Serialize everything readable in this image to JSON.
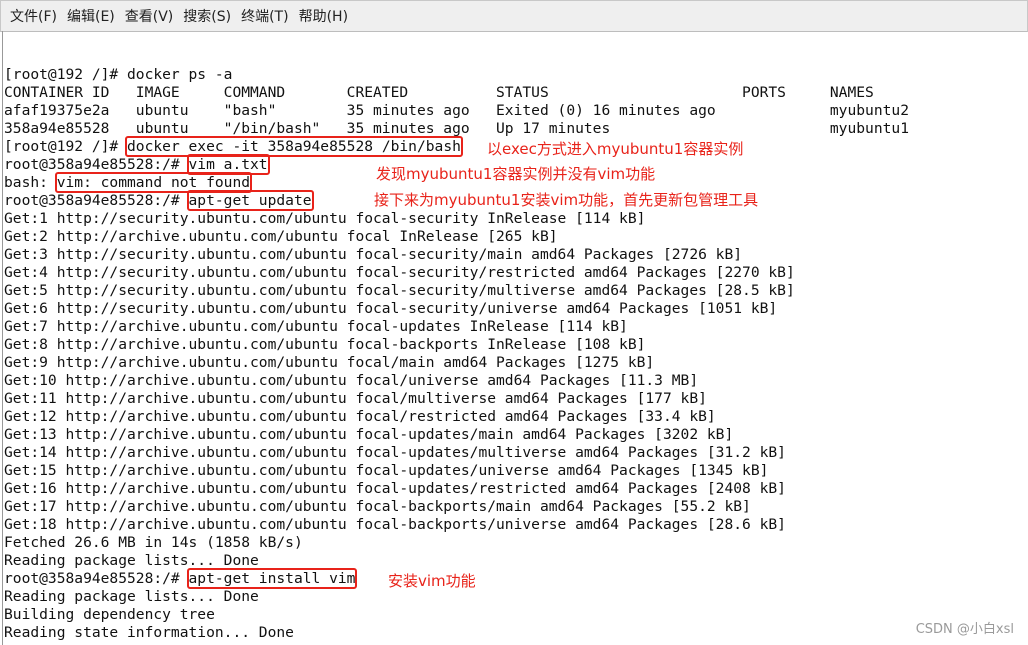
{
  "menu": [
    "文件(F)",
    "编辑(E)",
    "查看(V)",
    "搜索(S)",
    "终端(T)",
    "帮助(H)"
  ],
  "lines": {
    "l0": "[root@192 /]# docker ps -a",
    "l1": "CONTAINER ID   IMAGE     COMMAND       CREATED          STATUS                      PORTS     NAMES",
    "l2": "afaf19375e2a   ubuntu    \"bash\"        35 minutes ago   Exited (0) 16 minutes ago             myubuntu2",
    "l3": "358a94e85528   ubuntu    \"/bin/bash\"   35 minutes ago   Up 17 minutes                         myubuntu1",
    "l4p": "[root@192 /]# ",
    "l4b": "docker exec -it 358a94e85528 /bin/bash",
    "l5p": "root@358a94e85528:/# ",
    "l5b": "vim a.txt",
    "l6p": "bash: ",
    "l6b": "vim: command not found",
    "l7p": "root@358a94e85528:/# ",
    "l7b": "apt-get update",
    "get": [
      "Get:1 http://security.ubuntu.com/ubuntu focal-security InRelease [114 kB]",
      "Get:2 http://archive.ubuntu.com/ubuntu focal InRelease [265 kB]",
      "Get:3 http://security.ubuntu.com/ubuntu focal-security/main amd64 Packages [2726 kB]",
      "Get:4 http://security.ubuntu.com/ubuntu focal-security/restricted amd64 Packages [2270 kB]",
      "Get:5 http://security.ubuntu.com/ubuntu focal-security/multiverse amd64 Packages [28.5 kB]",
      "Get:6 http://security.ubuntu.com/ubuntu focal-security/universe amd64 Packages [1051 kB]",
      "Get:7 http://archive.ubuntu.com/ubuntu focal-updates InRelease [114 kB]",
      "Get:8 http://archive.ubuntu.com/ubuntu focal-backports InRelease [108 kB]",
      "Get:9 http://archive.ubuntu.com/ubuntu focal/main amd64 Packages [1275 kB]",
      "Get:10 http://archive.ubuntu.com/ubuntu focal/universe amd64 Packages [11.3 MB]",
      "Get:11 http://archive.ubuntu.com/ubuntu focal/multiverse amd64 Packages [177 kB]",
      "Get:12 http://archive.ubuntu.com/ubuntu focal/restricted amd64 Packages [33.4 kB]",
      "Get:13 http://archive.ubuntu.com/ubuntu focal-updates/main amd64 Packages [3202 kB]",
      "Get:14 http://archive.ubuntu.com/ubuntu focal-updates/multiverse amd64 Packages [31.2 kB]",
      "Get:15 http://archive.ubuntu.com/ubuntu focal-updates/universe amd64 Packages [1345 kB]",
      "Get:16 http://archive.ubuntu.com/ubuntu focal-updates/restricted amd64 Packages [2408 kB]",
      "Get:17 http://archive.ubuntu.com/ubuntu focal-backports/main amd64 Packages [55.2 kB]",
      "Get:18 http://archive.ubuntu.com/ubuntu focal-backports/universe amd64 Packages [28.6 kB]"
    ],
    "fetched": "Fetched 26.6 MB in 14s (1858 kB/s)",
    "reading1": "Reading package lists... Done",
    "l_inst_p": "root@358a94e85528:/# ",
    "l_inst_b": "apt-get install vim",
    "reading2": "Reading package lists... Done",
    "building": "Building dependency tree",
    "state": "Reading state information... Done"
  },
  "annotations": {
    "a1": "以exec方式进入myubuntu1容器实例",
    "a2": "发现myubuntu1容器实例并没有vim功能",
    "a3": "接下来为myubuntu1安装vim功能，首先更新包管理工具",
    "a4": "安装vim功能"
  },
  "watermark": "CSDN @小白xsl",
  "colors": {
    "annotation": "#e8231a"
  }
}
